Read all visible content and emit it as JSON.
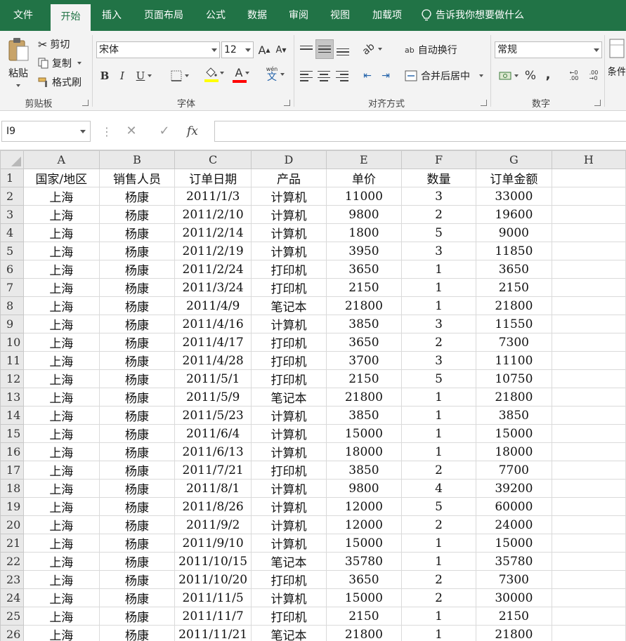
{
  "menu": {
    "tabs": [
      {
        "label": "文件"
      },
      {
        "label": "开始"
      },
      {
        "label": "插入"
      },
      {
        "label": "页面布局"
      },
      {
        "label": "公式"
      },
      {
        "label": "数据"
      },
      {
        "label": "审阅"
      },
      {
        "label": "视图"
      },
      {
        "label": "加载项"
      }
    ],
    "active_tab": "开始",
    "tell_me": "告诉我你想要做什么"
  },
  "ribbon": {
    "clipboard": {
      "paste": "粘贴",
      "cut": "剪切",
      "copy": "复制",
      "format_painter": "格式刷",
      "group_label": "剪贴板"
    },
    "font": {
      "font_name": "宋体",
      "font_size": "12",
      "grow": "A",
      "shrink": "A",
      "bold": "B",
      "italic": "I",
      "underline": "U",
      "font_color_letter": "A",
      "phonetic": "文",
      "phonetic_small": "wén",
      "group_label": "字体",
      "highlight_color": "#ffff00",
      "font_color": "#ff0000"
    },
    "alignment": {
      "wrap_text": "自动换行",
      "wrap_icon": "ab",
      "merge_center": "合并后居中",
      "group_label": "对齐方式"
    },
    "number": {
      "format": "常规",
      "percent": "%",
      "comma": ",",
      "group_label": "数字"
    },
    "styles": {
      "conditional": "条件"
    }
  },
  "formula_bar": {
    "name_box": "I9",
    "cancel": "✕",
    "enter": "✓",
    "fx": "fx",
    "formula": ""
  },
  "sheet": {
    "columns": [
      "A",
      "B",
      "C",
      "D",
      "E",
      "F",
      "G",
      "H"
    ],
    "header_row": [
      "国家/地区",
      "销售人员",
      "订单日期",
      "产品",
      "单价",
      "数量",
      "订单金额",
      ""
    ],
    "rows": [
      [
        "上海",
        "杨康",
        "2011/1/3",
        "计算机",
        "11000",
        "3",
        "33000",
        ""
      ],
      [
        "上海",
        "杨康",
        "2011/2/10",
        "计算机",
        "9800",
        "2",
        "19600",
        ""
      ],
      [
        "上海",
        "杨康",
        "2011/2/14",
        "计算机",
        "1800",
        "5",
        "9000",
        ""
      ],
      [
        "上海",
        "杨康",
        "2011/2/19",
        "计算机",
        "3950",
        "3",
        "11850",
        ""
      ],
      [
        "上海",
        "杨康",
        "2011/2/24",
        "打印机",
        "3650",
        "1",
        "3650",
        ""
      ],
      [
        "上海",
        "杨康",
        "2011/3/24",
        "打印机",
        "2150",
        "1",
        "2150",
        ""
      ],
      [
        "上海",
        "杨康",
        "2011/4/9",
        "笔记本",
        "21800",
        "1",
        "21800",
        ""
      ],
      [
        "上海",
        "杨康",
        "2011/4/16",
        "计算机",
        "3850",
        "3",
        "11550",
        ""
      ],
      [
        "上海",
        "杨康",
        "2011/4/17",
        "打印机",
        "3650",
        "2",
        "7300",
        ""
      ],
      [
        "上海",
        "杨康",
        "2011/4/28",
        "打印机",
        "3700",
        "3",
        "11100",
        ""
      ],
      [
        "上海",
        "杨康",
        "2011/5/1",
        "打印机",
        "2150",
        "5",
        "10750",
        ""
      ],
      [
        "上海",
        "杨康",
        "2011/5/9",
        "笔记本",
        "21800",
        "1",
        "21800",
        ""
      ],
      [
        "上海",
        "杨康",
        "2011/5/23",
        "计算机",
        "3850",
        "1",
        "3850",
        ""
      ],
      [
        "上海",
        "杨康",
        "2011/6/4",
        "计算机",
        "15000",
        "1",
        "15000",
        ""
      ],
      [
        "上海",
        "杨康",
        "2011/6/13",
        "计算机",
        "18000",
        "1",
        "18000",
        ""
      ],
      [
        "上海",
        "杨康",
        "2011/7/21",
        "打印机",
        "3850",
        "2",
        "7700",
        ""
      ],
      [
        "上海",
        "杨康",
        "2011/8/1",
        "计算机",
        "9800",
        "4",
        "39200",
        ""
      ],
      [
        "上海",
        "杨康",
        "2011/8/26",
        "计算机",
        "12000",
        "5",
        "60000",
        ""
      ],
      [
        "上海",
        "杨康",
        "2011/9/2",
        "计算机",
        "12000",
        "2",
        "24000",
        ""
      ],
      [
        "上海",
        "杨康",
        "2011/9/10",
        "计算机",
        "15000",
        "1",
        "15000",
        ""
      ],
      [
        "上海",
        "杨康",
        "2011/10/15",
        "笔记本",
        "35780",
        "1",
        "35780",
        ""
      ],
      [
        "上海",
        "杨康",
        "2011/10/20",
        "打印机",
        "3650",
        "2",
        "7300",
        ""
      ],
      [
        "上海",
        "杨康",
        "2011/11/5",
        "计算机",
        "15000",
        "2",
        "30000",
        ""
      ],
      [
        "上海",
        "杨康",
        "2011/11/7",
        "打印机",
        "2150",
        "1",
        "2150",
        ""
      ],
      [
        "上海",
        "杨康",
        "2011/11/21",
        "笔记本",
        "21800",
        "1",
        "21800",
        ""
      ]
    ]
  }
}
